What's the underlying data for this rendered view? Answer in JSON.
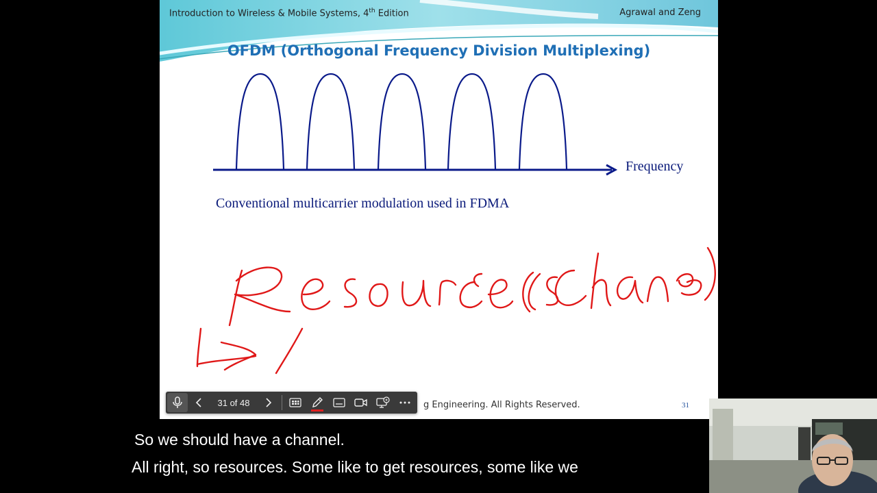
{
  "slide": {
    "header_left": "Introduction to Wireless & Mobile Systems, 4",
    "header_left_sup": "th",
    "header_left_suffix": " Edition",
    "header_right": "Agrawal and Zeng",
    "title": "OFDM (Orthogonal Frequency Division Multiplexing)",
    "frequency_label": "Frequency",
    "caption": "Conventional multicarrier modulation used in FDMA",
    "footer": "g Engineering. All Rights Reserved.",
    "page_number": "31",
    "handwriting": "Resources (Channels)",
    "colors": {
      "title": "#1f6fb5",
      "diagram": "#0a1a8a",
      "ink": "#e01818"
    }
  },
  "toolbar": {
    "slide_counter": "31 of 48",
    "buttons": [
      "microphone-icon",
      "chevron-left-icon",
      "chevron-right-icon",
      "slides-grid-icon",
      "pen-icon",
      "subtitles-icon",
      "camera-icon",
      "presenter-view-icon",
      "more-icon"
    ]
  },
  "captions": {
    "line1": "So we should have a channel.",
    "line2": "All right, so resources. Some like to get resources, some like we"
  }
}
